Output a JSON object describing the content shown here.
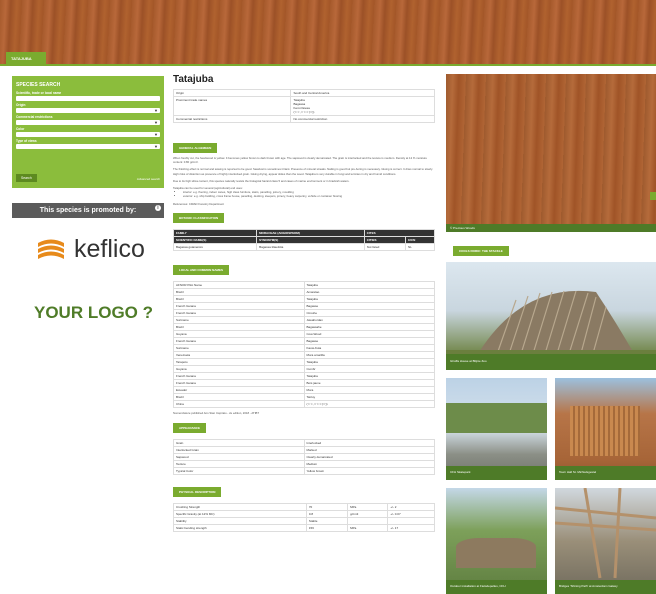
{
  "tab": "TATAJUBA",
  "search": {
    "title": "SPECIES SEARCH",
    "fields": [
      {
        "label": "Scientific, trade or local name"
      },
      {
        "label": "Origin",
        "select": true
      },
      {
        "label": "Commercial restrictions",
        "select": true
      },
      {
        "label": "Color",
        "select": true
      },
      {
        "label": "Type of views",
        "select": true
      }
    ],
    "button": "Search",
    "advanced": "Advanced search"
  },
  "promo": {
    "text": "This species is promoted by:",
    "brand": "keflico",
    "your_logo": "YOUR LOGO ?"
  },
  "species": {
    "title": "Tatajuba",
    "info": [
      [
        "Origin",
        "South and Central America"
      ],
      [
        "Prominent trade names",
        "Tatajuba\nBagassa\nKeni-Osiesa\n(☆☆,☆☆☆(☆))"
      ],
      [
        "Commercial restrictions",
        "No commercial restriction"
      ]
    ],
    "buttons": {
      "general": "GENERAL ALGEMEEN",
      "family": "BOTANIC CLASSIFICATION",
      "names": "LOCAL AND COMMON NAMES",
      "appearance": "APPEARANCE",
      "physical": "PHYSICAL DESCRIPTION"
    },
    "paragraphs": [
      "When freshly cut, the heartwood is yellow. It becomes yellow brown to dark brown with age. The sapwood is clearly demarcated. The grain is interlocked and the texture is medium. Density at 12 % moisture content: 0.80 g/cm3.",
      "The finishing effect is normal and sawing is reported to be good. Sawdust is sometimes irritant. Presence of mineral streaks. Nailing is good but pre-boring is necessary. Gluing is correct. It dries normal to slowly. High risks of distortion as presence of highly interlocked grain. Gluing drying, appear slides than the wood. Tatajuba is very durable in fungi and termites in dry and humid conditions.",
      "Due to its high silica content, this species naturally resists the biological hazard class 5 and cases of marine environment or in brackish waters.",
      "Tatajuba can be used for several (agricultural) end uses:"
    ],
    "bullets": [
      "interior: e.g. flooring, indoor canes, high class furniture, stairs, panelling, joinery, moulding",
      "exterior: e.g. ship building, cross frame house, panelling, decking, sleepers, joinery, heavy carpentry, vehicle or container flooring"
    ],
    "references": "References: CIRAD Forestry Department",
    "family_table": {
      "headers": [
        "FAMILY",
        "MORACEAE (ANGIOSPERM)",
        "CITES"
      ],
      "subheaders": [
        "SCIENTIFIC NAME(S)",
        "SYNONYM(S)",
        "CITIES",
        "IUCN"
      ],
      "row": [
        "Bagassa guianensis",
        "Bagassa tiliaefolia",
        "Not listed",
        "NL"
      ]
    },
    "names": [
      [
        "AFNOR Pilot Name",
        "Tatajuba"
      ],
      [
        "Brazil",
        "Amarelao"
      ],
      [
        "Brazil",
        "Tatajuba"
      ],
      [
        "French Guiana",
        "Bagasse"
      ],
      [
        "French Guiana",
        "Cirouhe"
      ],
      [
        "Suriname",
        "Jawahurdan"
      ],
      [
        "Brazil",
        "Bagassahe"
      ],
      [
        "Guyana",
        "Cow-Wood"
      ],
      [
        "French Guiana",
        "Bagasse"
      ],
      [
        "Suriname",
        "Kauw-Kuta"
      ],
      [
        "Venezuela",
        "Mora amarilla"
      ],
      [
        "Tarapoto",
        "Tatajuba"
      ],
      [
        "Guyana",
        "Cumbr"
      ],
      [
        "French Guiana",
        "Tatajuba"
      ],
      [
        "French Guiana",
        "Bois jaune"
      ],
      [
        "Ecuador",
        "Mora"
      ],
      [
        "Brazil",
        "Tatzuy"
      ],
      [
        "China",
        "(☆☆,☆☆☆(☆))"
      ]
    ],
    "names_note": "Nomenclature published Ans Stan Inspirato - 2e edition, 2018 - ATIBT",
    "appearance": [
      [
        "Grain",
        "Interlocked"
      ],
      [
        "Interlocked Grain",
        "Marked"
      ],
      [
        "Sapwood",
        "Clearly demarcated"
      ],
      [
        "Texture",
        "Medium"
      ],
      [
        "Typical Color",
        "Yellow brown"
      ]
    ],
    "physical": [
      [
        "Crushing Strength",
        "70",
        "MPa",
        "+/- 2"
      ],
      [
        "Specific Gravity (at 12% MC)",
        "0.8",
        "g/cm3",
        "+/- 0.07"
      ],
      [
        "Stability",
        "Stable",
        "",
        ""
      ],
      [
        "Static bending strength",
        "156",
        "MPa",
        "+/- 17"
      ]
    ]
  },
  "right": {
    "hero_caption": "© Precious Woods",
    "button": "COOLS DORIC: THE STACKLE",
    "photos": [
      "Ghoffa House at Blijnie Zoo",
      "CFH Skatepark",
      "Town Hall St. Michielsgestel",
      "Outdoor installation at Fietsdepelles, CFH",
      "Bridges 'Shining Path' at Amsterdam Galaxy"
    ]
  }
}
